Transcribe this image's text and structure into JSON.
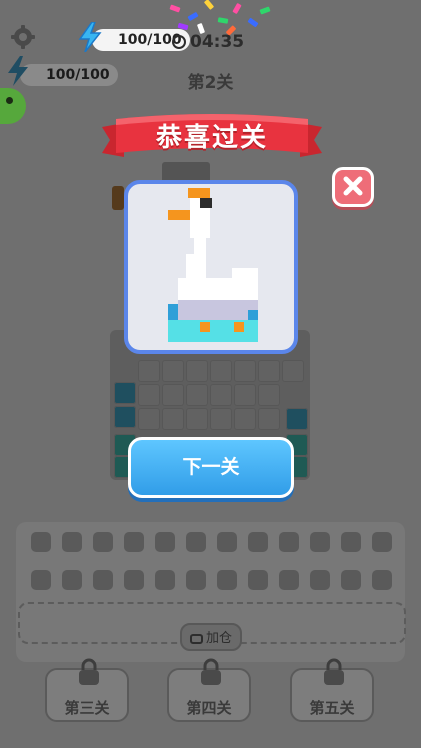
{
  "hud": {
    "settings_icon": "gear-icon",
    "energy_icon": "lightning-icon",
    "energy_value": "100/100",
    "energy_value_behind": "100/100",
    "timer_icon": "clock-icon",
    "timer": "04:35",
    "level_title": "第2关"
  },
  "dialog": {
    "banner": "恭喜过关",
    "close_icon": "close-icon",
    "picture": "pixel-goose-picture",
    "next_button": "下一关"
  },
  "tray": {
    "ad_button": "加仓",
    "ad_icon": "video-icon"
  },
  "levels": [
    {
      "label": "第三关",
      "locked": true
    },
    {
      "label": "第四关",
      "locked": true
    },
    {
      "label": "第五关",
      "locked": true
    }
  ],
  "colors": {
    "overlay": "#6f6f6f",
    "ribbon_red": "#e8333f",
    "close_pink": "#ee6d78",
    "card_border": "#5b86ea",
    "next_button_blue": "#319de8"
  }
}
